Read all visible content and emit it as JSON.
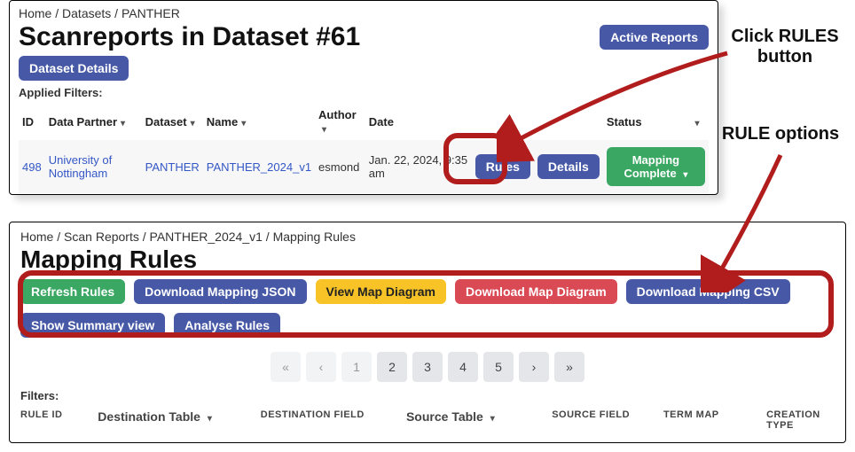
{
  "panel1": {
    "breadcrumb": [
      "Home",
      "Datasets",
      "PANTHER"
    ],
    "title": "Scanreports in Dataset #61",
    "active_reports": "Active Reports",
    "dataset_details": "Dataset Details",
    "applied_filters": "Applied Filters:",
    "headers": {
      "id": "ID",
      "partner": "Data Partner",
      "dataset": "Dataset",
      "name": "Name",
      "author": "Author",
      "date": "Date",
      "status": "Status"
    },
    "row": {
      "id": "498",
      "partner": "University of Nottingham",
      "dataset": "PANTHER",
      "name": "PANTHER_2024_v1",
      "author": "esmond",
      "date": "Jan. 22, 2024, 9:35 am",
      "rules": "Rules",
      "details": "Details",
      "status": "Mapping Complete"
    }
  },
  "panel2": {
    "breadcrumb": [
      "Home",
      "Scan Reports",
      "PANTHER_2024_v1",
      "Mapping Rules"
    ],
    "title": "Mapping Rules",
    "buttons": {
      "refresh": "Refresh Rules",
      "dl_json": "Download Mapping JSON",
      "view_diag": "View Map Diagram",
      "dl_diag": "Download Map Diagram",
      "dl_csv": "Download Mapping CSV",
      "summary": "Show Summary view",
      "analyse": "Analyse Rules"
    },
    "pager": [
      "«",
      "‹",
      "1",
      "2",
      "3",
      "4",
      "5",
      "›",
      "»"
    ],
    "filters": "Filters:",
    "cols": {
      "rule_id": "RULE ID",
      "dest_table": "Destination Table",
      "dest_field": "DESTINATION FIELD",
      "src_table": "Source Table",
      "src_field": "SOURCE FIELD",
      "term_map": "TERM MAP",
      "creation": "CREATION TYPE"
    }
  },
  "annot": {
    "click_rules": "Click RULES button",
    "rule_options": "RULE options"
  }
}
